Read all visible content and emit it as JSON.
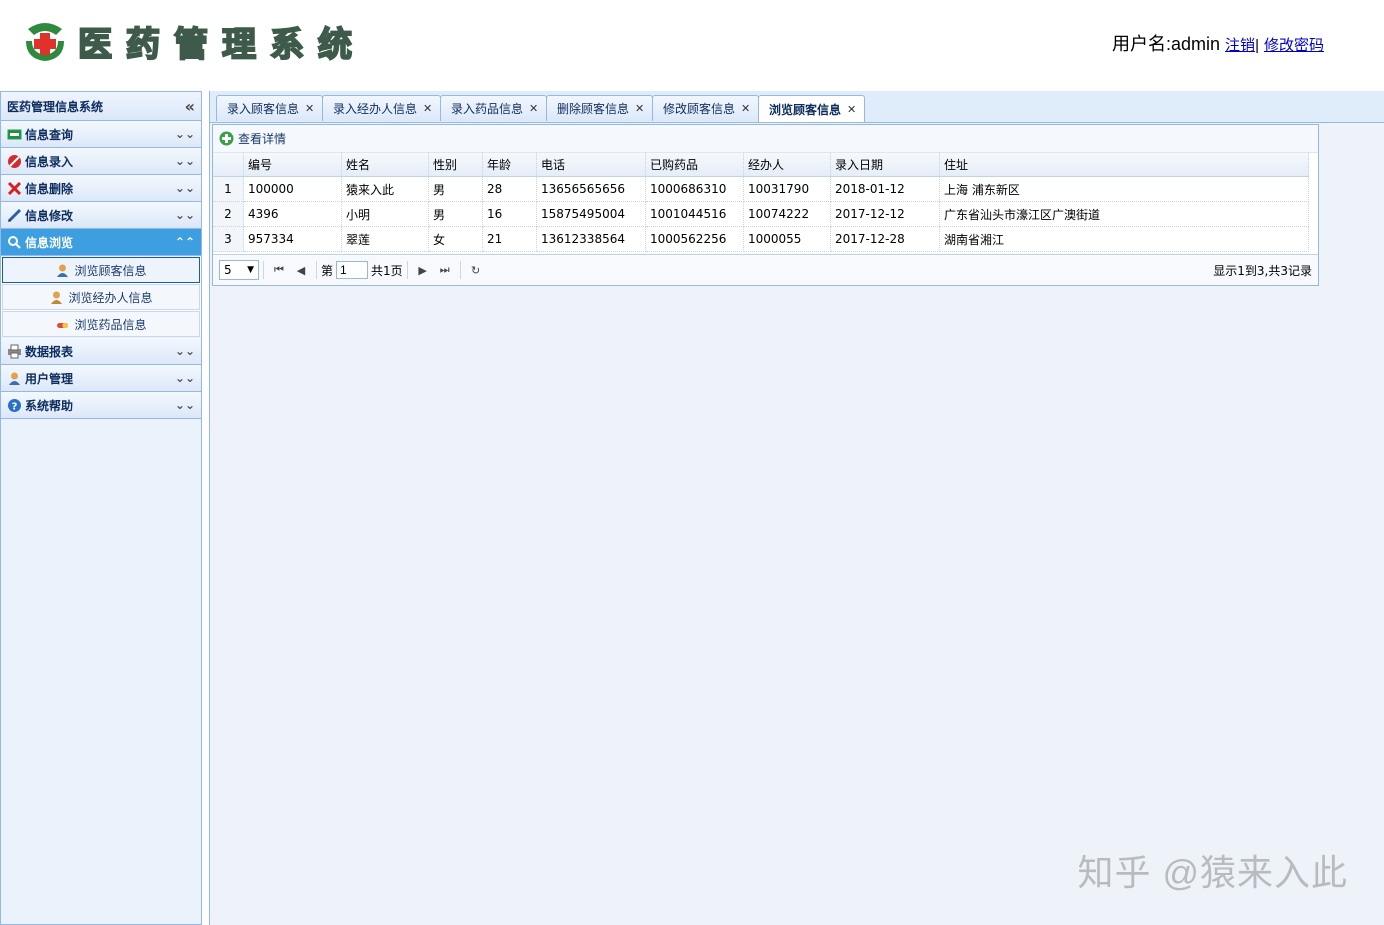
{
  "header": {
    "app_title": "医药管理系统",
    "user_label": "用户名:admin",
    "logout_link": "注销",
    "separator": "|",
    "change_password_link": "修改密码"
  },
  "sidebar": {
    "title": "医药管理信息系统",
    "collapse_glyph": "«",
    "menus": [
      {
        "label": "信息查询",
        "icon": "list-icon"
      },
      {
        "label": "信息录入",
        "icon": "no-entry-icon"
      },
      {
        "label": "信息删除",
        "icon": "delete-icon"
      },
      {
        "label": "信息修改",
        "icon": "edit-icon"
      },
      {
        "label": "信息浏览",
        "icon": "search-icon",
        "active": true,
        "items": [
          {
            "label": "浏览顾客信息",
            "icon": "customer-icon"
          },
          {
            "label": "浏览经办人信息",
            "icon": "staff-icon"
          },
          {
            "label": "浏览药品信息",
            "icon": "medicine-icon"
          }
        ]
      },
      {
        "label": "数据报表",
        "icon": "printer-icon"
      },
      {
        "label": "用户管理",
        "icon": "user-icon"
      },
      {
        "label": "系统帮助",
        "icon": "help-icon"
      }
    ]
  },
  "tabs": [
    {
      "label": "录入顾客信息"
    },
    {
      "label": "录入经办人信息"
    },
    {
      "label": "录入药品信息"
    },
    {
      "label": "删除顾客信息"
    },
    {
      "label": "修改顾客信息"
    },
    {
      "label": "浏览顾客信息",
      "active": true
    }
  ],
  "toolbar": {
    "details_label": "查看详情"
  },
  "grid": {
    "columns": [
      "编号",
      "姓名",
      "性别",
      "年龄",
      "电话",
      "已购药品",
      "经办人",
      "录入日期",
      "住址"
    ],
    "rows": [
      [
        "1",
        "100000",
        "猿来入此",
        "男",
        "28",
        "13656565656",
        "1000686310",
        "10031790",
        "2018-01-12",
        "上海 浦东新区"
      ],
      [
        "2",
        "4396",
        "小明",
        "男",
        "16",
        "15875495004",
        "1001044516",
        "10074222",
        "2017-12-12",
        "广东省汕头市濠江区广澳街道"
      ],
      [
        "3",
        "957334",
        "翠莲",
        "女",
        "21",
        "13612338564",
        "1000562256",
        "1000055",
        "2017-12-28",
        "湖南省湘江"
      ]
    ]
  },
  "pager": {
    "page_size": "5",
    "page_prefix": "第",
    "page_value": "1",
    "page_total": "共1页",
    "info": "显示1到3,共3记录"
  },
  "watermark": "知乎 @猿来入此",
  "colors": {
    "accent": "#3d9fe0",
    "border": "#95b8e7"
  }
}
